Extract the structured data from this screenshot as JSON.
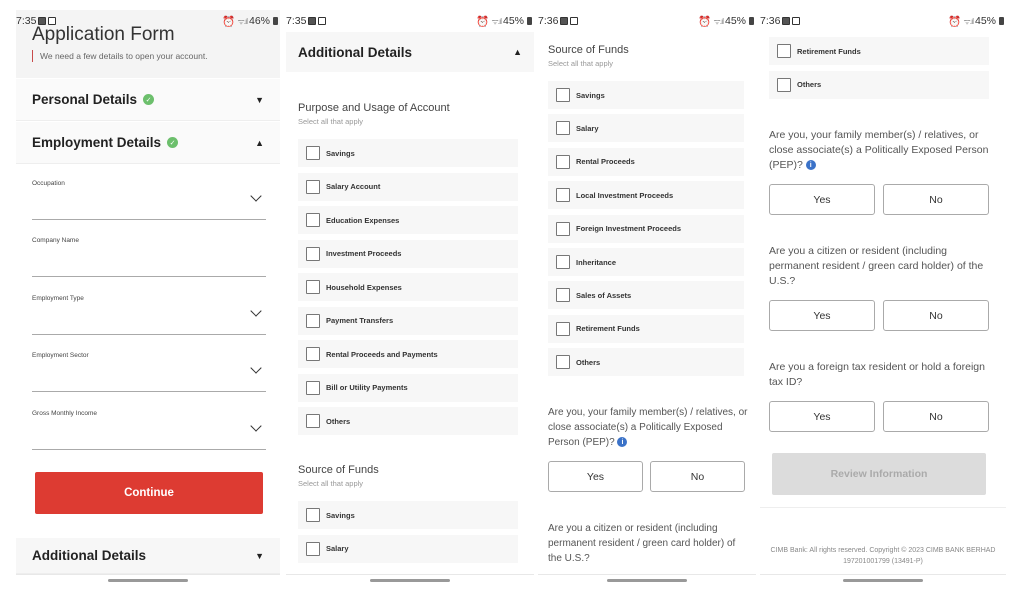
{
  "screens": [
    {
      "status": {
        "time": "7:35",
        "battery": "46%"
      },
      "hero": {
        "title": "Application Form",
        "subtitle": "We need a few details to open your account."
      },
      "sections": {
        "personal": {
          "title": "Personal Details",
          "completed": true
        },
        "employment": {
          "title": "Employment Details",
          "completed": true
        },
        "additional": {
          "title": "Additional Details"
        }
      },
      "fields": [
        {
          "label": "Occupation",
          "type": "dropdown",
          "value": ""
        },
        {
          "label": "Company Name",
          "type": "text",
          "value": ""
        },
        {
          "label": "Employment Type",
          "type": "dropdown",
          "value": ""
        },
        {
          "label": "Employment Sector",
          "type": "dropdown",
          "value": ""
        },
        {
          "label": "Gross Monthly Income",
          "type": "dropdown",
          "value": ""
        }
      ],
      "continue_label": "Continue"
    },
    {
      "status": {
        "time": "7:35",
        "battery": "45%"
      },
      "section_title": "Additional Details",
      "purpose": {
        "title": "Purpose and Usage of Account",
        "hint": "Select all that apply",
        "options": [
          "Savings",
          "Salary Account",
          "Education Expenses",
          "Investment Proceeds",
          "Household Expenses",
          "Payment Transfers",
          "Rental Proceeds and Payments",
          "Bill or Utility Payments",
          "Others"
        ]
      },
      "funds": {
        "title": "Source of Funds",
        "hint": "Select all that apply",
        "options": [
          "Savings",
          "Salary"
        ]
      }
    },
    {
      "status": {
        "time": "7:36",
        "battery": "45%"
      },
      "funds": {
        "title": "Source of Funds",
        "hint": "Select all that apply",
        "options": [
          "Savings",
          "Salary",
          "Rental Proceeds",
          "Local Investment Proceeds",
          "Foreign Investment Proceeds",
          "Inheritance",
          "Sales of Assets",
          "Retirement Funds",
          "Others"
        ]
      },
      "q_pep": "Are you, your family member(s) / relatives, or close associate(s) a Politically Exposed Person (PEP)?",
      "q_us": "Are you a citizen or resident (including permanent resident / green card holder) of the U.S.?",
      "yes": "Yes",
      "no": "No"
    },
    {
      "status": {
        "time": "7:36",
        "battery": "45%"
      },
      "funds_options": [
        "Retirement Funds",
        "Others"
      ],
      "q_pep": "Are you, your family member(s) / relatives, or close associate(s) a Politically Exposed Person (PEP)?",
      "q_us": "Are you a citizen or resident (including permanent resident / green card holder) of the U.S.?",
      "q_tax": "Are you a foreign tax resident or hold a foreign tax ID?",
      "yes": "Yes",
      "no": "No",
      "review_label": "Review Information",
      "footer_line1": "CIMB Bank: All rights reserved. Copyright © 2023 CIMB BANK BERHAD",
      "footer_line2": "197201001799 (13491-P)"
    }
  ],
  "colors": {
    "primary": "#dd3b32",
    "success": "#6cbf6c",
    "info": "#3b72c8",
    "disabled": "#dcdcdc"
  }
}
